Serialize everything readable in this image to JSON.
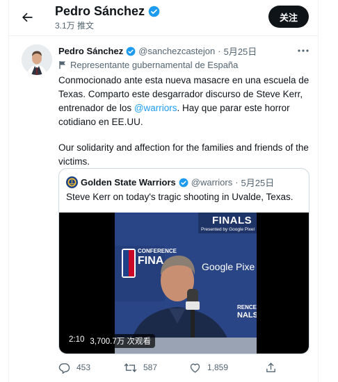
{
  "header": {
    "title": "Pedro Sánchez",
    "subtitle": "3.1万 推文",
    "follow_label": "关注"
  },
  "tweet": {
    "author_name": "Pedro Sánchez",
    "handle": "@sanchezcastejon",
    "separator": "·",
    "date": "5月25日",
    "affiliation": "Representante gubernamental de España",
    "text_part1": "Conmocionado ante esta nueva masacre en una escuela de Texas. Comparto este desgarrador discurso de Steve Kerr, entrenador de los ",
    "mention": "@warriors",
    "text_part2": ". Hay que parar este horror cotidiano en EE.UU.",
    "text_en": "Our solidarity and affection for the families and friends of the victims."
  },
  "quote": {
    "author_name": "Golden State Warriors",
    "handle": "@warriors",
    "separator": "·",
    "date": "5月25日",
    "text": "Steve Kerr on today's tragic shooting in Uvalde, Texas.",
    "video": {
      "duration": "2:10",
      "views": "3,700.7万 次观看",
      "backdrop_text": {
        "finals": "FINALS",
        "presented_by": "Presented by Google Pixel",
        "conference": "CONFERENCE",
        "finals_short": "FINA",
        "google_pixel": "Google Pixe",
        "conference_right": "RENCE",
        "nals": "NALS"
      }
    }
  },
  "actions": {
    "replies": "453",
    "retweets": "587",
    "likes": "1,859"
  },
  "colors": {
    "accent": "#1d9bf0",
    "verified": "#1d9bf0",
    "text": "#0f1419",
    "muted": "#536471",
    "backdrop_blue": "#1f3a78"
  },
  "icons": [
    "back-arrow-icon",
    "verified-badge-icon",
    "more-icon",
    "government-flag-icon",
    "reply-icon",
    "retweet-icon",
    "like-icon",
    "share-icon"
  ]
}
